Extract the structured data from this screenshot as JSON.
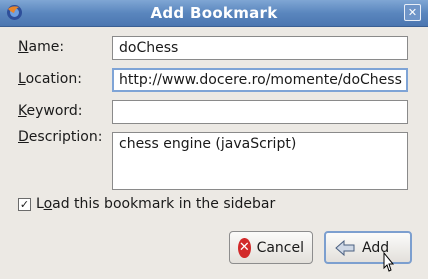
{
  "window": {
    "title": "Add Bookmark"
  },
  "labels": {
    "name": {
      "mnemonic": "N",
      "rest": "ame:"
    },
    "location": {
      "mnemonic": "L",
      "rest": "ocation:"
    },
    "keyword": {
      "mnemonic": "K",
      "rest": "eyword:"
    },
    "description": {
      "mnemonic": "D",
      "rest": "escription:"
    }
  },
  "fields": {
    "name_value": "doChess",
    "location_value": "http://www.docere.ro/momente/doChess",
    "keyword_value": "",
    "description_value": "chess engine (javaScript)"
  },
  "sidebar_option": {
    "checked": true,
    "prefix": "L",
    "mnemonic": "o",
    "rest": "ad this bookmark in the sidebar"
  },
  "buttons": {
    "cancel_label": "Cancel",
    "add_label": "Add"
  },
  "icons": {
    "app": "firefox-icon",
    "close": "close-icon",
    "cancel": "cancel-icon",
    "add": "add-bookmark-icon",
    "cursor": "mouse-pointer-icon"
  },
  "colors": {
    "titlebar": "#5a86be",
    "focus_border": "#7fa4d6",
    "cancel_icon": "#d22a2a"
  }
}
